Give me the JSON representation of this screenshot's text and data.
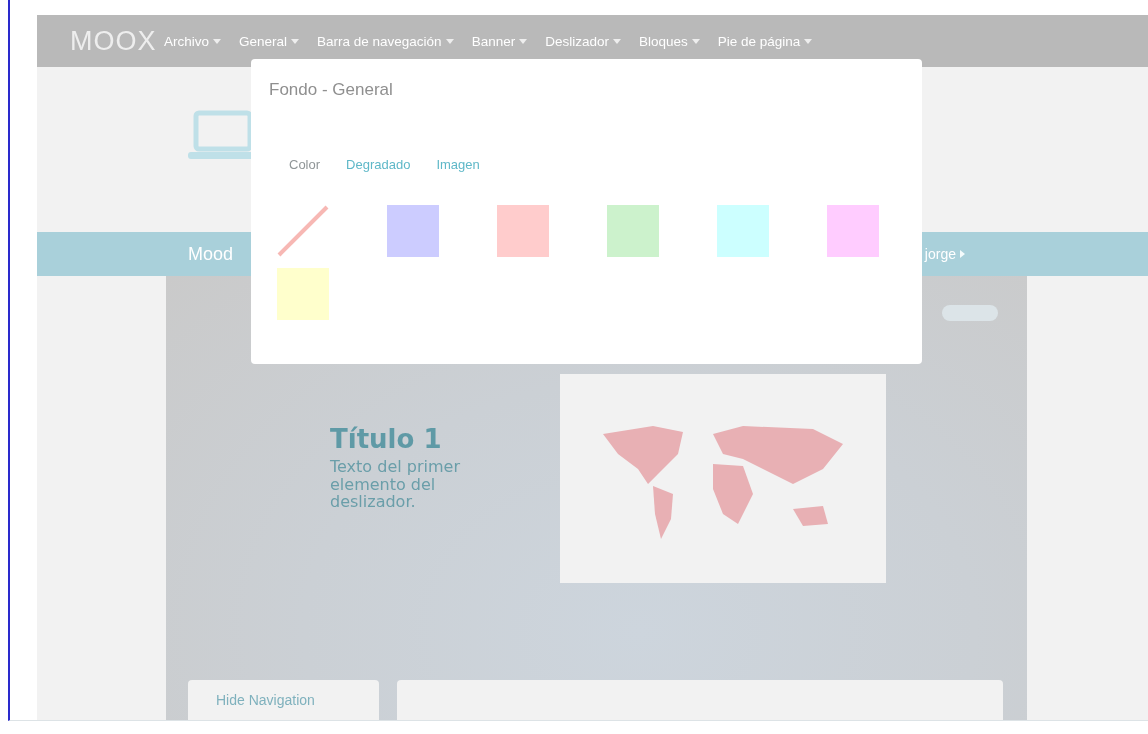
{
  "navbar": {
    "logo": "MOOX",
    "menu": [
      {
        "label": "Archivo"
      },
      {
        "label": "General"
      },
      {
        "label": "Barra de navegación"
      },
      {
        "label": "Banner"
      },
      {
        "label": "Deslizador"
      },
      {
        "label": "Bloques"
      },
      {
        "label": "Pie de página"
      }
    ]
  },
  "banner": {
    "site_name": "Mood",
    "user": "jorge"
  },
  "slider": {
    "title": "Título 1",
    "text": "Texto del primer elemento del deslizador.",
    "hide_button": "Hide Navigation"
  },
  "modal": {
    "title": "Fondo - General",
    "tabs": [
      {
        "label": "Color",
        "selected": true
      },
      {
        "label": "Degradado",
        "selected": false
      },
      {
        "label": "Imagen",
        "selected": false
      }
    ],
    "swatches": [
      {
        "kind": "none"
      },
      {
        "kind": "color",
        "color": "#ccccff"
      },
      {
        "kind": "color",
        "color": "#ffcccc"
      },
      {
        "kind": "color",
        "color": "#ccf2cc"
      },
      {
        "kind": "color",
        "color": "#ccffff"
      },
      {
        "kind": "color",
        "color": "#ffccff"
      },
      {
        "kind": "color",
        "color": "#ffffcc"
      }
    ]
  }
}
